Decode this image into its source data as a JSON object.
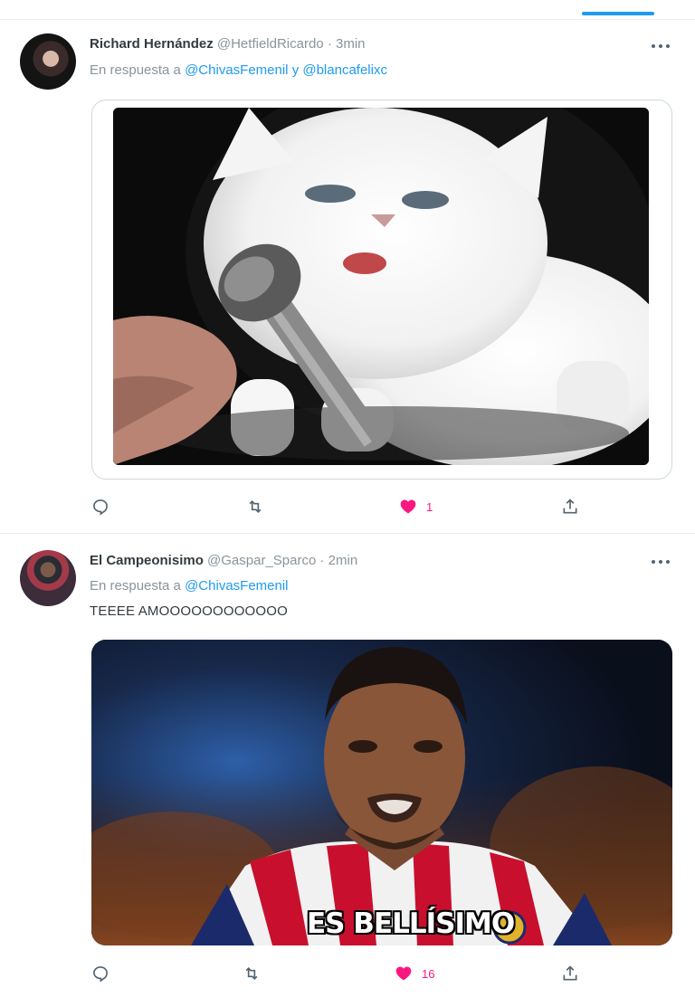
{
  "tweets": [
    {
      "author_name": "Richard Hernández",
      "handle": "@HetfieldRicardo",
      "time": "· 3min",
      "reply_prefix": "En respuesta a",
      "mentions": [
        "@ChivasFemenil",
        "@blancafelixc"
      ],
      "mention_joiner": "y",
      "text": "",
      "media": {
        "type": "gif",
        "subject": "white kitten singing into microphone"
      },
      "like_count": "1",
      "liked": true
    },
    {
      "author_name": "El Campeonisimo",
      "handle": "@Gaspar_Sparco",
      "time": "· 2min",
      "reply_prefix": "En respuesta a",
      "mentions": [
        "@ChivasFemenil"
      ],
      "text": "TEEEE AMOOOOOOOOOOOO",
      "media": {
        "type": "image",
        "caption": "ES BELLÍSIMO"
      },
      "like_count": "16",
      "liked": true
    }
  ],
  "colors": {
    "accent": "#1d9bf0",
    "like": "#f91880",
    "muted": "#8a949c",
    "icon": "#536471",
    "divider": "#e6ecf0"
  },
  "icons": [
    "more-icon",
    "reply-icon",
    "retweet-icon",
    "like-icon",
    "share-icon"
  ]
}
